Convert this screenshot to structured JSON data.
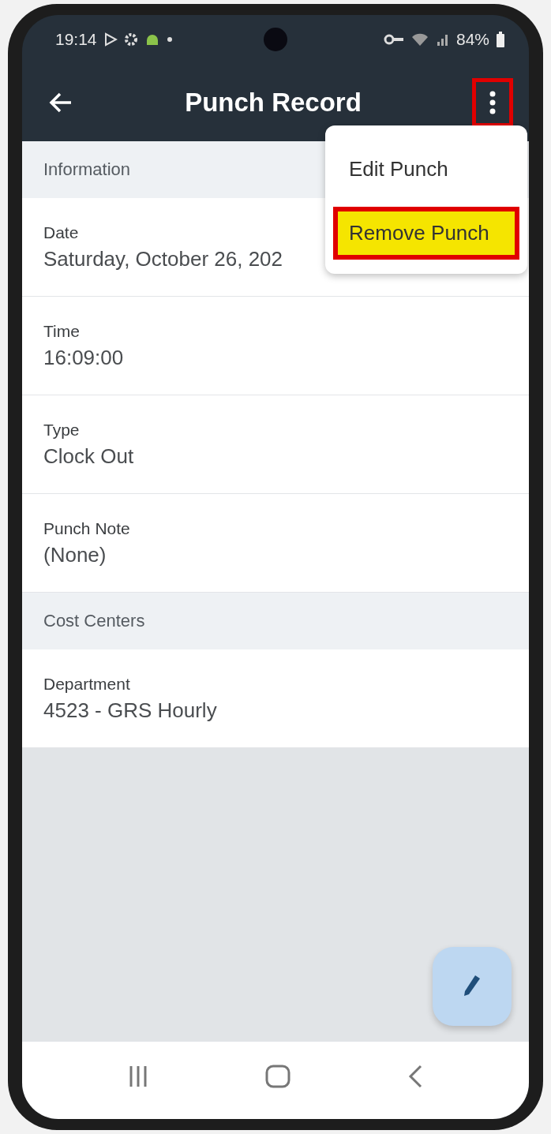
{
  "status_bar": {
    "time": "19:14",
    "battery": "84%"
  },
  "app_bar": {
    "title": "Punch Record",
    "menu_outlined": true
  },
  "menu": {
    "items": [
      {
        "label": "Edit Punch",
        "highlighted": false
      },
      {
        "label": "Remove Punch",
        "highlighted": true
      }
    ]
  },
  "sections": [
    {
      "title": "Information",
      "fields": [
        {
          "label": "Date",
          "value": "Saturday, October 26, 202"
        },
        {
          "label": "Time",
          "value": "16:09:00"
        },
        {
          "label": "Type",
          "value": "Clock Out"
        },
        {
          "label": "Punch Note",
          "value": "(None)"
        }
      ]
    },
    {
      "title": "Cost Centers",
      "fields": [
        {
          "label": "Department",
          "value": "4523 - GRS Hourly"
        }
      ]
    }
  ]
}
